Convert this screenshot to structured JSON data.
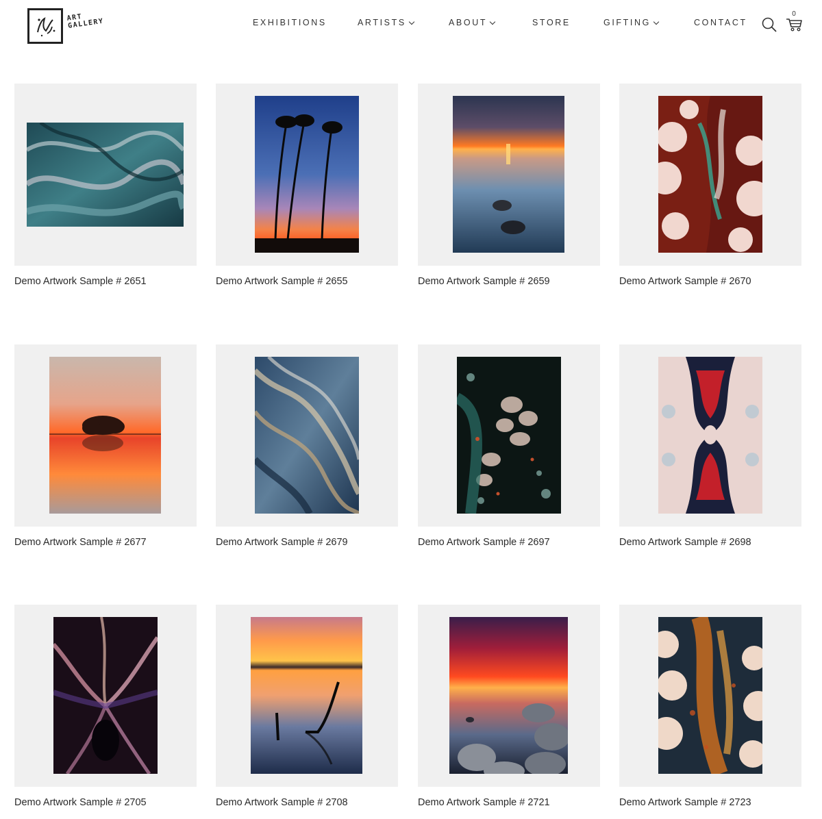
{
  "site": {
    "logo_line1": "ART",
    "logo_line2": "GALLERY"
  },
  "nav": {
    "items": [
      {
        "label": "EXHIBITIONS",
        "dropdown": false
      },
      {
        "label": "ARTISTS",
        "dropdown": true
      },
      {
        "label": "ABOUT",
        "dropdown": true
      },
      {
        "label": "STORE",
        "dropdown": false
      },
      {
        "label": "GIFTING",
        "dropdown": true
      },
      {
        "label": "CONTACT",
        "dropdown": false
      }
    ],
    "search_icon": "search-icon",
    "cart_icon": "cart-icon",
    "cart_count": "0"
  },
  "artworks": [
    {
      "title": "Demo Artwork Sample # 2651",
      "style": "teal-marble"
    },
    {
      "title": "Demo Artwork Sample # 2655",
      "style": "palm-sunset"
    },
    {
      "title": "Demo Artwork Sample # 2659",
      "style": "lake-sunset"
    },
    {
      "title": "Demo Artwork Sample # 2670",
      "style": "red-cream-fluid"
    },
    {
      "title": "Demo Artwork Sample # 2677",
      "style": "island-sunset"
    },
    {
      "title": "Demo Artwork Sample # 2679",
      "style": "blue-gold-marble"
    },
    {
      "title": "Demo Artwork Sample # 2697",
      "style": "dark-cells"
    },
    {
      "title": "Demo Artwork Sample # 2698",
      "style": "mirror-red-navy"
    },
    {
      "title": "Demo Artwork Sample # 2705",
      "style": "purple-burst"
    },
    {
      "title": "Demo Artwork Sample # 2708",
      "style": "driftwood-dusk"
    },
    {
      "title": "Demo Artwork Sample # 2721",
      "style": "rocky-sunset"
    },
    {
      "title": "Demo Artwork Sample # 2723",
      "style": "orange-navy-fluid"
    }
  ],
  "colors": {
    "frame_bg": "#f0f0f0",
    "text": "#2a2a2a",
    "nav_text": "#333333"
  }
}
